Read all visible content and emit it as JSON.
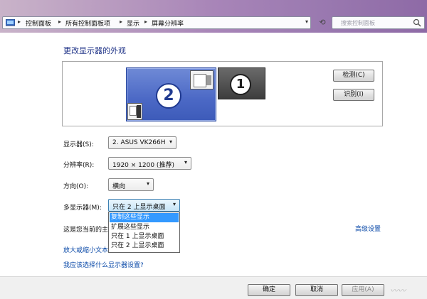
{
  "address_bar": {
    "crumbs": [
      "控制面板",
      "所有控制面板项",
      "显示",
      "屏幕分辨率"
    ]
  },
  "search": {
    "placeholder": "搜索控制面板"
  },
  "page_title": "更改显示器的外观",
  "monitors": [
    {
      "number": "2",
      "selected": true
    },
    {
      "number": "1",
      "selected": false
    }
  ],
  "buttons": {
    "detect": "检测(C)",
    "identify": "识别(I)",
    "ok": "确定",
    "cancel": "取消",
    "apply": "应用(A)"
  },
  "settings": {
    "display": {
      "label": "显示器(S):",
      "value": "2. ASUS VK266H"
    },
    "resolution": {
      "label": "分辨率(R):",
      "value": "1920 × 1200 (推荐)"
    },
    "orientation": {
      "label": "方向(O):",
      "value": "横向"
    },
    "multi": {
      "label": "多显示器(M):",
      "value": "只在 2 上显示桌面",
      "options": [
        "复制这些显示",
        "扩展这些显示",
        "只在 1 上显示桌面",
        "只在 2 上显示桌面"
      ],
      "highlighted_option": "复制这些显示"
    }
  },
  "info_text": "这是您当前的主",
  "links": {
    "advanced": "高级设置",
    "resize_text": "放大或缩小文本",
    "which_settings": "我应该选择什么显示器设置?"
  },
  "colors": {
    "titlebar": "#a885b8",
    "selected_monitor": "#4b68c5",
    "link": "#0b4aa8",
    "dropdown_highlight": "#3399ff"
  }
}
